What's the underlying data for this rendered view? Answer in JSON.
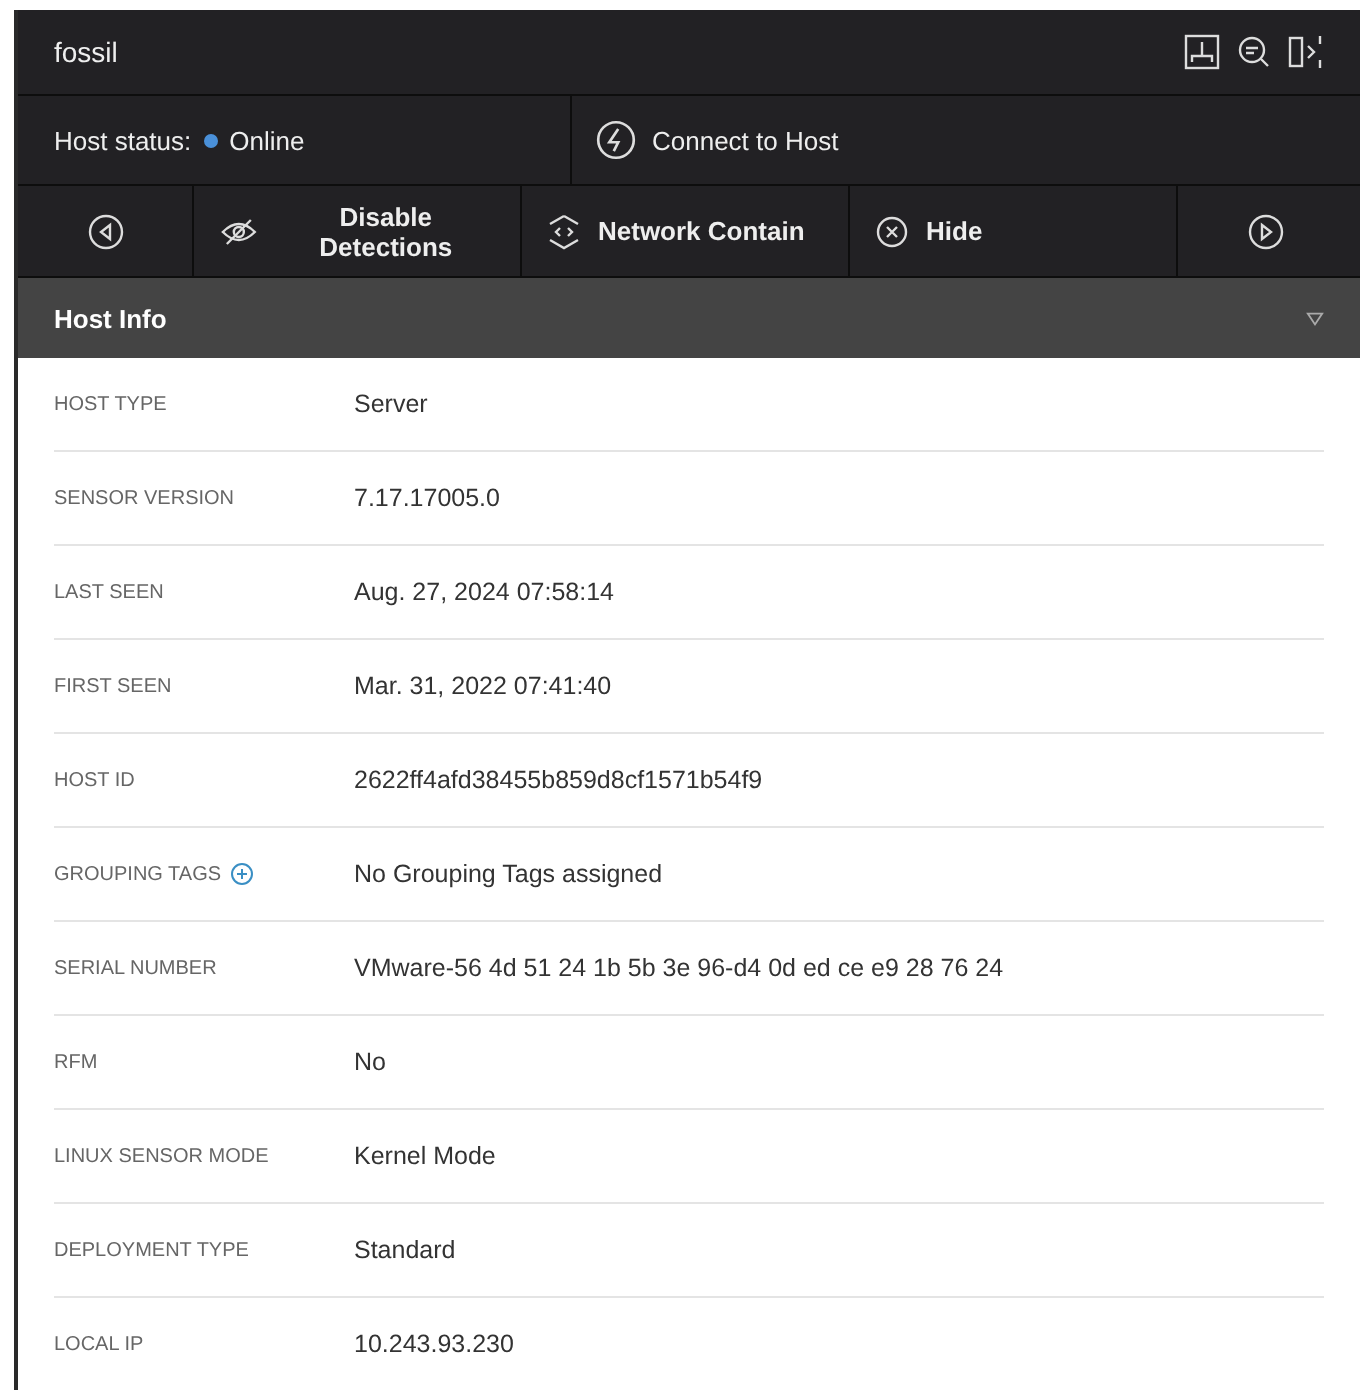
{
  "window": {
    "title": "fossil"
  },
  "host_status": {
    "label": "Host status:",
    "value": "Online",
    "color": "#4a90d9"
  },
  "connect_button": {
    "label": "Connect to Host"
  },
  "actions": [
    {
      "kind": "prev"
    },
    {
      "kind": "disable",
      "label": "Disable Detections"
    },
    {
      "kind": "contain",
      "label": "Network Contain"
    },
    {
      "kind": "hide",
      "label": "Hide"
    },
    {
      "kind": "next"
    }
  ],
  "section": {
    "title": "Host Info",
    "expanded": true
  },
  "fields": [
    {
      "kind": "text",
      "label": "HOST TYPE",
      "value": "Server"
    },
    {
      "kind": "text",
      "label": "SENSOR VERSION",
      "value": "7.17.17005.0"
    },
    {
      "kind": "text",
      "label": "LAST SEEN",
      "value": "Aug. 27, 2024 07:58:14"
    },
    {
      "kind": "text",
      "label": "FIRST SEEN",
      "value": "Mar. 31, 2022 07:41:40"
    },
    {
      "kind": "text",
      "label": "HOST ID",
      "value": "2622ff4afd38455b859d8cf1571b54f9"
    },
    {
      "kind": "addable",
      "label": "GROUPING TAGS",
      "value": "No Grouping Tags assigned"
    },
    {
      "kind": "text",
      "label": "SERIAL NUMBER",
      "value": "VMware-56 4d 51 24 1b 5b 3e 96-d4 0d ed ce e9 28 76 24"
    },
    {
      "kind": "text",
      "label": "RFM",
      "value": "No"
    },
    {
      "kind": "text",
      "label": "LINUX SENSOR MODE",
      "value": "Kernel Mode"
    },
    {
      "kind": "text",
      "label": "DEPLOYMENT TYPE",
      "value": "Standard"
    },
    {
      "kind": "text",
      "label": "LOCAL IP",
      "value": "10.243.93.230"
    }
  ]
}
